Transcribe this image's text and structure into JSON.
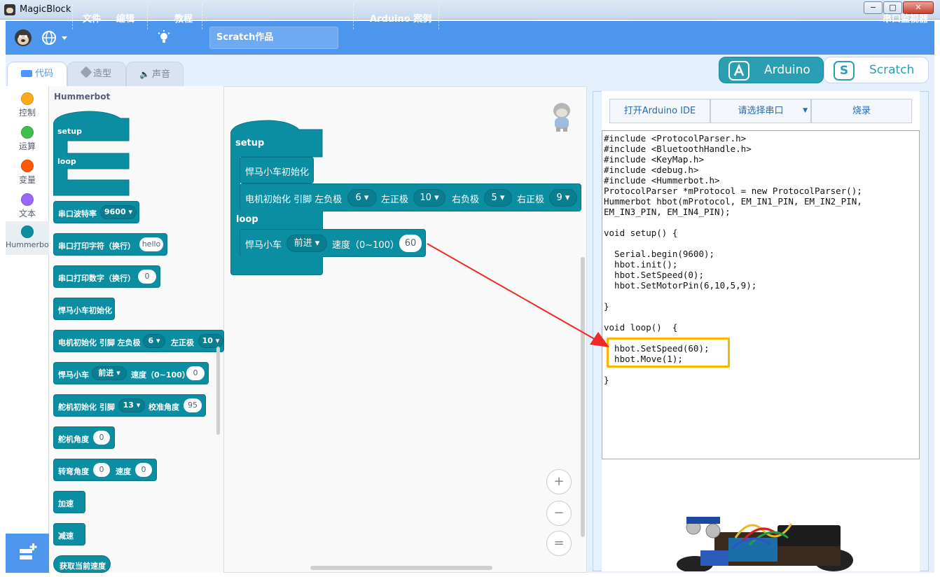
{
  "window": {
    "title": "MagicBlock",
    "min": "−",
    "max": "□",
    "close": "✕"
  },
  "menu": {
    "lang_icon": "globe-icon",
    "file": "文件",
    "edit": "编辑",
    "tutorial": "教程",
    "project_name": "Scratch作品",
    "arduino_examples": "Arduino 案例",
    "serial_monitor": "串口监视器"
  },
  "tabs": {
    "code": "代码",
    "costume": "造型",
    "sound": "声音"
  },
  "categories": [
    {
      "label": "控制",
      "color": "#ffab19"
    },
    {
      "label": "运算",
      "color": "#40bf4a"
    },
    {
      "label": "变量",
      "color": "#ff5800"
    },
    {
      "label": "文本",
      "color": "#9966ff"
    },
    {
      "label": "Hummerbot",
      "color": "#0c8ea2"
    }
  ],
  "palette": {
    "title": "Hummerbot",
    "setup": "setup",
    "loop": "loop",
    "baud_label": "串口波特率",
    "baud_value": "9600",
    "print_str_label": "串口打印字符（换行）",
    "print_str_value": "hello",
    "print_num_label": "串口打印数字（换行）",
    "print_num_value": "0",
    "init_label": "悍马小车初始化",
    "motor_label": "电机初始化 引脚  左负极",
    "motor_v1": "6",
    "motor_l2": "左正极",
    "motor_v2": "10",
    "car_label": "悍马小车",
    "car_dir": "前进",
    "car_speed_label": "速度（0~100）",
    "car_speed": "0",
    "servo_label": "舵机初始化 引脚",
    "servo_pin": "13",
    "servo_cal": "校准角度",
    "servo_cal_value": "95",
    "servo_angle_label": "舵机角度",
    "servo_angle_value": "0",
    "turn_label": "转弯角度",
    "turn_value": "0",
    "turn_speed_label": "速度",
    "turn_speed_value": "0",
    "accel": "加速",
    "decel": "减速",
    "get_speed": "获取当前速度"
  },
  "script": {
    "setup": "setup",
    "init": "悍马小车初始化",
    "motor_label": "电机初始化 引脚  左负极",
    "lneg": "6",
    "lpos_label": "左正极",
    "lpos": "10",
    "rneg_label": "右负极",
    "rneg": "5",
    "rpos_label": "右正极",
    "rpos": "9",
    "loop": "loop",
    "car_label": "悍马小车",
    "dir": "前进",
    "speed_label": "速度（0~100）",
    "speed": "60"
  },
  "zoom": {
    "in": "+",
    "out": "−",
    "reset": "="
  },
  "mode": {
    "arduino": "Arduino",
    "scratch": "Scratch"
  },
  "arduino_panel": {
    "open_ide": "打开Arduino IDE",
    "select_port": "请选择串口",
    "upload": "烧录"
  },
  "code": "#include <ProtocolParser.h>\n#include <BluetoothHandle.h>\n#include <KeyMap.h>\n#include <debug.h>\n#include <Hummerbot.h>\nProtocolParser *mProtocol = new ProtocolParser();\nHummerbot hbot(mProtocol, EM_IN1_PIN, EM_IN2_PIN,\nEM_IN3_PIN, EM_IN4_PIN);\n\nvoid setup() {\n\n  Serial.begin(9600);\n  hbot.init();\n  hbot.SetSpeed(0);\n  hbot.SetMotorPin(6,10,5,9);\n\n}\n\nvoid loop()  {\n\n  hbot.SetSpeed(60);\n  hbot.Move(1);\n\n}",
  "colors": {
    "accent": "#4d96ee",
    "block": "#0c8ea2",
    "highlight": "#f5b800",
    "arrow": "#ee2a24"
  }
}
